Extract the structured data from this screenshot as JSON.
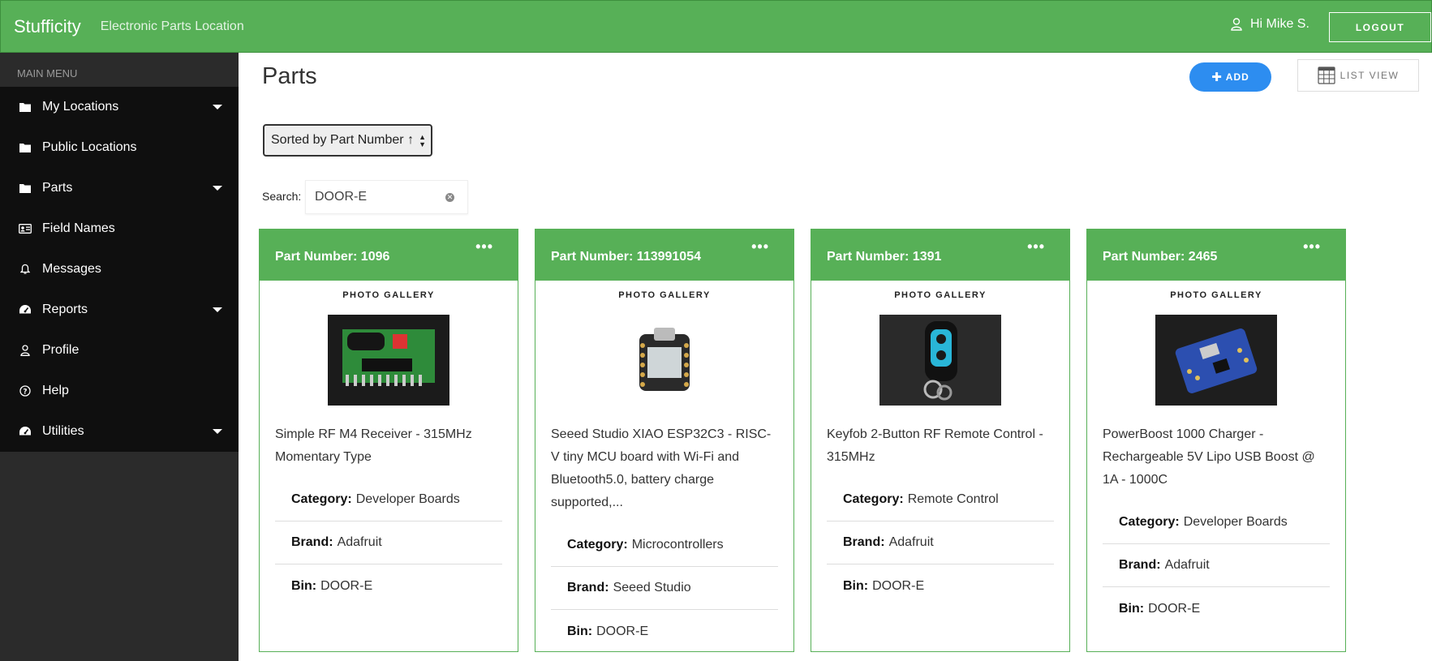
{
  "header": {
    "brand": "Stufficity",
    "subtitle": "Electronic Parts Location",
    "greeting": "Hi Mike S.",
    "logout_label": "LOGOUT"
  },
  "sidebar": {
    "heading": "MAIN MENU",
    "items": [
      {
        "label": "My Locations",
        "icon": "folder-icon",
        "has_submenu": true
      },
      {
        "label": "Public Locations",
        "icon": "folder-icon",
        "has_submenu": false
      },
      {
        "label": "Parts",
        "icon": "folder-icon",
        "has_submenu": true
      },
      {
        "label": "Field Names",
        "icon": "id-card-icon",
        "has_submenu": false
      },
      {
        "label": "Messages",
        "icon": "bell-icon",
        "has_submenu": false
      },
      {
        "label": "Reports",
        "icon": "dashboard-icon",
        "has_submenu": true
      },
      {
        "label": "Profile",
        "icon": "user-icon",
        "has_submenu": false
      },
      {
        "label": "Help",
        "icon": "question-circle-icon",
        "has_submenu": false
      },
      {
        "label": "Utilities",
        "icon": "dashboard-icon",
        "has_submenu": true
      }
    ]
  },
  "main": {
    "title": "Parts",
    "add_label": "ADD",
    "list_view_label": "LIST VIEW",
    "sort": {
      "selected": "Sorted by Part Number ↑"
    },
    "search": {
      "label": "Search:",
      "value": "DOOR-E"
    }
  },
  "cards": [
    {
      "part_number": "Part Number: 1096",
      "gallery_label": "PHOTO GALLERY",
      "description": "Simple RF M4 Receiver - 315MHz Momentary Type",
      "fields": [
        {
          "label": "Category:",
          "value": "Developer Boards"
        },
        {
          "label": "Brand:",
          "value": "Adafruit"
        },
        {
          "label": "Bin:",
          "value": "DOOR-E"
        }
      ]
    },
    {
      "part_number": "Part Number: 113991054",
      "gallery_label": "PHOTO GALLERY",
      "description": "Seeed Studio XIAO ESP32C3 - RISC-V tiny MCU board with Wi-Fi and Bluetooth5.0, battery charge supported,...",
      "fields": [
        {
          "label": "Category:",
          "value": "Microcontrollers"
        },
        {
          "label": "Brand:",
          "value": "Seeed Studio"
        },
        {
          "label": "Bin:",
          "value": "DOOR-E"
        }
      ]
    },
    {
      "part_number": "Part Number: 1391",
      "gallery_label": "PHOTO GALLERY",
      "description": "Keyfob 2-Button RF Remote Control - 315MHz",
      "fields": [
        {
          "label": "Category:",
          "value": "Remote Control"
        },
        {
          "label": "Brand:",
          "value": "Adafruit"
        },
        {
          "label": "Bin:",
          "value": "DOOR-E"
        }
      ]
    },
    {
      "part_number": "Part Number: 2465",
      "gallery_label": "PHOTO GALLERY",
      "description": "PowerBoost 1000 Charger - Rechargeable 5V Lipo USB Boost @ 1A - 1000C",
      "fields": [
        {
          "label": "Category:",
          "value": "Developer Boards"
        },
        {
          "label": "Brand:",
          "value": "Adafruit"
        },
        {
          "label": "Bin:",
          "value": "DOOR-E"
        }
      ]
    }
  ],
  "colors": {
    "header_green": "#57b057",
    "sidebar_dark": "#2b2b2b",
    "menu_black": "#0f0f0f",
    "add_blue": "#2d8df0"
  }
}
